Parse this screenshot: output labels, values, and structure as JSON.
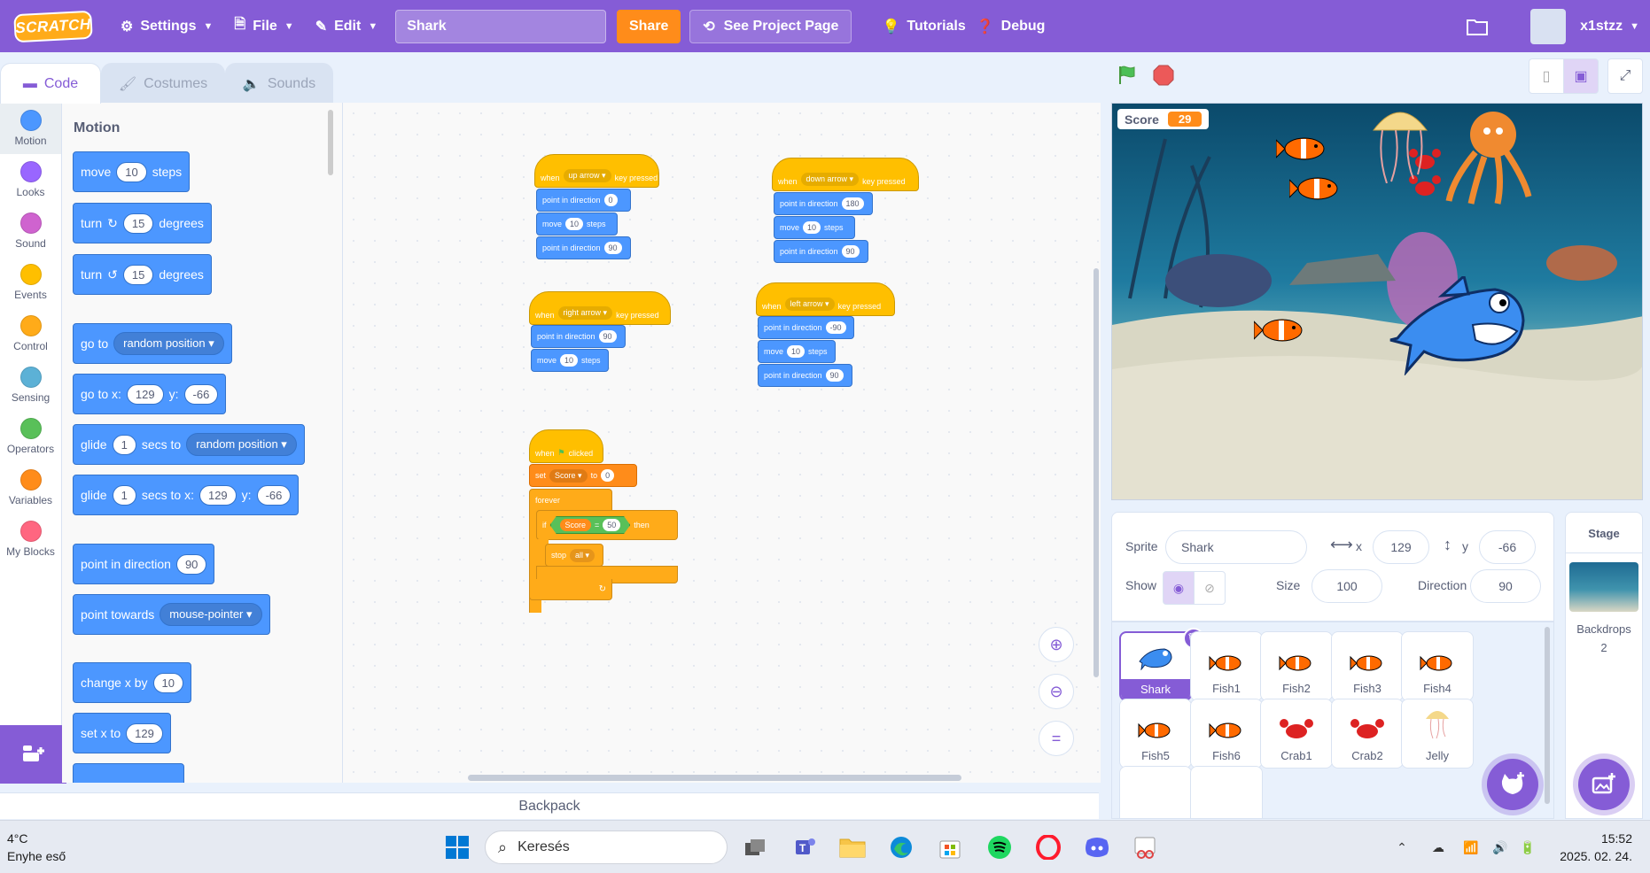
{
  "menubar": {
    "logo": "SCRATCH",
    "settings": "Settings",
    "file": "File",
    "edit": "Edit",
    "project_title": "Shark",
    "share": "Share",
    "see_project_page": "See Project Page",
    "tutorials": "Tutorials",
    "debug": "Debug",
    "username": "x1stzz"
  },
  "tabs": {
    "code": "Code",
    "costumes": "Costumes",
    "sounds": "Sounds"
  },
  "categories": [
    {
      "label": "Motion",
      "color": "#4c97ff"
    },
    {
      "label": "Looks",
      "color": "#9966ff"
    },
    {
      "label": "Sound",
      "color": "#cf63cf"
    },
    {
      "label": "Events",
      "color": "#ffbf00"
    },
    {
      "label": "Control",
      "color": "#ffab19"
    },
    {
      "label": "Sensing",
      "color": "#5cb1d6"
    },
    {
      "label": "Operators",
      "color": "#59c059"
    },
    {
      "label": "Variables",
      "color": "#ff8c1a"
    },
    {
      "label": "My Blocks",
      "color": "#ff6680"
    }
  ],
  "palette": {
    "title": "Motion",
    "move": {
      "a": "move",
      "n": "10",
      "b": "steps"
    },
    "turn_right": {
      "a": "turn",
      "n": "15",
      "b": "degrees"
    },
    "turn_left": {
      "a": "turn",
      "n": "15",
      "b": "degrees"
    },
    "goto": {
      "a": "go to",
      "dd": "random position"
    },
    "gotoxy": {
      "a": "go to x:",
      "x": "129",
      "ylabel": "y:",
      "y": "-66"
    },
    "glide_to": {
      "a": "glide",
      "n": "1",
      "b": "secs to",
      "dd": "random position"
    },
    "glide_xy": {
      "a": "glide",
      "n": "1",
      "b": "secs to x:",
      "x": "129",
      "ylabel": "y:",
      "y": "-66"
    },
    "point_dir": {
      "a": "point in direction",
      "n": "90"
    },
    "point_towards": {
      "a": "point towards",
      "dd": "mouse-pointer"
    },
    "change_x": {
      "a": "change x by",
      "n": "10"
    },
    "set_x": {
      "a": "set x to",
      "n": "129"
    }
  },
  "scripts": {
    "when": "when",
    "key_pressed": "key pressed",
    "point_in_direction": "point in direction",
    "move": "move",
    "steps": "steps",
    "clicked": "clicked",
    "set": "set",
    "to": "to",
    "forever": "forever",
    "if": "if",
    "then": "then",
    "stop": "stop",
    "eq": "=",
    "up": {
      "key": "up arrow",
      "dir": "0",
      "steps": "10",
      "dir2": "90"
    },
    "down": {
      "key": "down arrow",
      "dir": "180",
      "steps": "10",
      "dir2": "90"
    },
    "right": {
      "key": "right arrow",
      "dir": "90",
      "steps": "10"
    },
    "left": {
      "key": "left arrow",
      "dir": "-90",
      "steps": "10",
      "dir2": "90"
    },
    "flag": {
      "var": "Score",
      "val": "0",
      "cmp_var": "Score",
      "cmp_val": "50",
      "stop_opt": "all"
    }
  },
  "backpack": "Backpack",
  "stage": {
    "score_label": "Score",
    "score_value": "29"
  },
  "sprite_info": {
    "sprite_label": "Sprite",
    "sprite_name": "Shark",
    "x_label": "x",
    "x": "129",
    "y_label": "y",
    "y": "-66",
    "show_label": "Show",
    "size_label": "Size",
    "size": "100",
    "direction_label": "Direction",
    "direction": "90"
  },
  "sprites": [
    "Shark",
    "Fish1",
    "Fish2",
    "Fish3",
    "Fish4",
    "Fish5",
    "Fish6",
    "Crab1",
    "Crab2",
    "Jelly"
  ],
  "stage_pane": {
    "title": "Stage",
    "backdrops_label": "Backdrops",
    "backdrops_count": "2"
  },
  "taskbar": {
    "weather_temp": "4°C",
    "weather_desc": "Enyhe eső",
    "search_placeholder": "Keresés",
    "time": "15:52",
    "date": "2025. 02. 24."
  },
  "colors": {
    "accent": "#855cd6",
    "motion": "#4c97ff",
    "events": "#ffbf00",
    "control": "#ffab19",
    "variables": "#ff8c1a",
    "operators": "#59c059"
  }
}
